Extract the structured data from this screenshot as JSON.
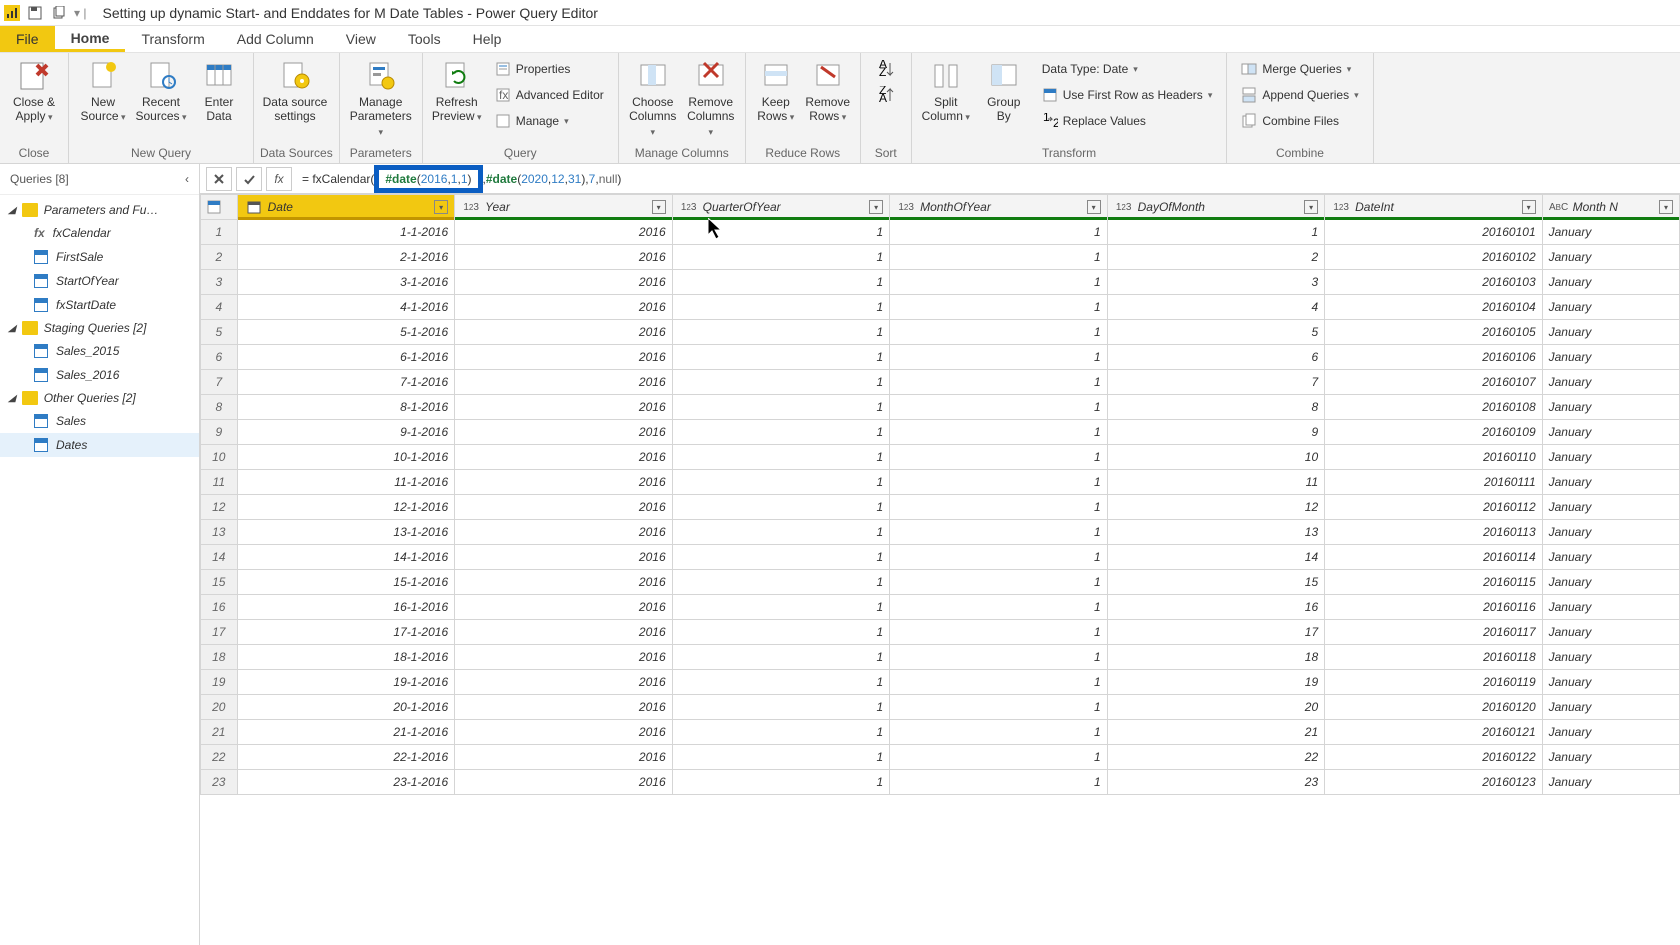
{
  "title": "Setting up dynamic Start- and Enddates for M Date Tables - Power Query Editor",
  "tabs": {
    "file": "File",
    "home": "Home",
    "transform": "Transform",
    "addcolumn": "Add Column",
    "view": "View",
    "tools": "Tools",
    "help": "Help"
  },
  "ribbon": {
    "close": {
      "apply": "Close &\nApply",
      "group": "Close"
    },
    "newquery": {
      "newsource": "New\nSource",
      "recent": "Recent\nSources",
      "enter": "Enter\nData",
      "group": "New Query"
    },
    "datasources": {
      "settings": "Data source\nsettings",
      "group": "Data Sources"
    },
    "parameters": {
      "manage": "Manage\nParameters",
      "group": "Parameters"
    },
    "query": {
      "refresh": "Refresh\nPreview",
      "properties": "Properties",
      "adveditor": "Advanced Editor",
      "manage": "Manage",
      "group": "Query"
    },
    "managecols": {
      "choose": "Choose\nColumns",
      "remove": "Remove\nColumns",
      "group": "Manage Columns"
    },
    "reducerows": {
      "keep": "Keep\nRows",
      "remove": "Remove\nRows",
      "group": "Reduce Rows"
    },
    "sort": {
      "group": "Sort"
    },
    "transform": {
      "split": "Split\nColumn",
      "groupby": "Group\nBy",
      "datatype": "Data Type: Date",
      "firstrow": "Use First Row as Headers",
      "replace": "Replace Values",
      "group": "Transform"
    },
    "combine": {
      "merge": "Merge Queries",
      "append": "Append Queries",
      "combinefiles": "Combine Files",
      "group": "Combine"
    }
  },
  "queries": {
    "title": "Queries [8]",
    "groups": {
      "params": "Parameters and Fu…",
      "staging": "Staging Queries [2]",
      "other": "Other Queries [2]"
    },
    "items": {
      "fxCalendar": "fxCalendar",
      "firstSale": "FirstSale",
      "startOfYear": "StartOfYear",
      "fxStartDate": "fxStartDate",
      "sales2015": "Sales_2015",
      "sales2016": "Sales_2016",
      "sales": "Sales",
      "dates": "Dates"
    }
  },
  "formula": {
    "prefix": "= fxCalendar(",
    "highlight_kw": "#date",
    "highlight_open": "( ",
    "highlight_y": "2016",
    "highlight_m": "1",
    "highlight_d": "1",
    "highlight_close": " )",
    "sep": ", ",
    "kw2": "#date",
    "open2": "( ",
    "y2": "2020",
    "m2": "12",
    "d2": "31",
    "close2": "), ",
    "arg3": "7",
    "arg4": "null",
    "tail": ")"
  },
  "columns": [
    "Date",
    "Year",
    "QuarterOfYear",
    "MonthOfYear",
    "DayOfMonth",
    "DateInt",
    "Month N"
  ],
  "colTypes": [
    "date",
    "num",
    "num",
    "num",
    "num",
    "num",
    "text"
  ],
  "rows": [
    [
      "1",
      "1-1-2016",
      "2016",
      "1",
      "1",
      "1",
      "20160101",
      "January"
    ],
    [
      "2",
      "2-1-2016",
      "2016",
      "1",
      "1",
      "2",
      "20160102",
      "January"
    ],
    [
      "3",
      "3-1-2016",
      "2016",
      "1",
      "1",
      "3",
      "20160103",
      "January"
    ],
    [
      "4",
      "4-1-2016",
      "2016",
      "1",
      "1",
      "4",
      "20160104",
      "January"
    ],
    [
      "5",
      "5-1-2016",
      "2016",
      "1",
      "1",
      "5",
      "20160105",
      "January"
    ],
    [
      "6",
      "6-1-2016",
      "2016",
      "1",
      "1",
      "6",
      "20160106",
      "January"
    ],
    [
      "7",
      "7-1-2016",
      "2016",
      "1",
      "1",
      "7",
      "20160107",
      "January"
    ],
    [
      "8",
      "8-1-2016",
      "2016",
      "1",
      "1",
      "8",
      "20160108",
      "January"
    ],
    [
      "9",
      "9-1-2016",
      "2016",
      "1",
      "1",
      "9",
      "20160109",
      "January"
    ],
    [
      "10",
      "10-1-2016",
      "2016",
      "1",
      "1",
      "10",
      "20160110",
      "January"
    ],
    [
      "11",
      "11-1-2016",
      "2016",
      "1",
      "1",
      "11",
      "20160111",
      "January"
    ],
    [
      "12",
      "12-1-2016",
      "2016",
      "1",
      "1",
      "12",
      "20160112",
      "January"
    ],
    [
      "13",
      "13-1-2016",
      "2016",
      "1",
      "1",
      "13",
      "20160113",
      "January"
    ],
    [
      "14",
      "14-1-2016",
      "2016",
      "1",
      "1",
      "14",
      "20160114",
      "January"
    ],
    [
      "15",
      "15-1-2016",
      "2016",
      "1",
      "1",
      "15",
      "20160115",
      "January"
    ],
    [
      "16",
      "16-1-2016",
      "2016",
      "1",
      "1",
      "16",
      "20160116",
      "January"
    ],
    [
      "17",
      "17-1-2016",
      "2016",
      "1",
      "1",
      "17",
      "20160117",
      "January"
    ],
    [
      "18",
      "18-1-2016",
      "2016",
      "1",
      "1",
      "18",
      "20160118",
      "January"
    ],
    [
      "19",
      "19-1-2016",
      "2016",
      "1",
      "1",
      "19",
      "20160119",
      "January"
    ],
    [
      "20",
      "20-1-2016",
      "2016",
      "1",
      "1",
      "20",
      "20160120",
      "January"
    ],
    [
      "21",
      "21-1-2016",
      "2016",
      "1",
      "1",
      "21",
      "20160121",
      "January"
    ],
    [
      "22",
      "22-1-2016",
      "2016",
      "1",
      "1",
      "22",
      "20160122",
      "January"
    ],
    [
      "23",
      "23-1-2016",
      "2016",
      "1",
      "1",
      "23",
      "20160123",
      "January"
    ]
  ]
}
